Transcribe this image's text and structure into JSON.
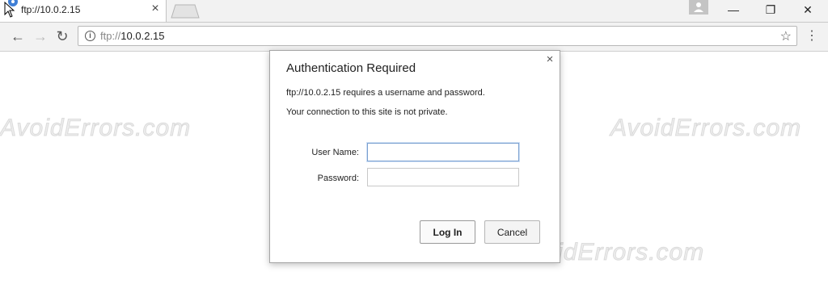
{
  "tab": {
    "title": "ftp://10.0.2.15",
    "close_label": "×"
  },
  "window": {
    "minimize_label": "—",
    "restore_label": "❐",
    "close_label": "✕"
  },
  "toolbar": {
    "back_label": "←",
    "forward_label": "→",
    "reload_label": "↻",
    "url_protocol": "ftp://",
    "url_host": "10.0.2.15",
    "bookmark_label": "☆",
    "menu_label": "⋮"
  },
  "watermark": {
    "text": "AvoidErrors.com"
  },
  "dialog": {
    "title": "Authentication Required",
    "message_line1": "ftp://10.0.2.15 requires a username and password.",
    "message_line2": "Your connection to this site is not private.",
    "close_label": "×",
    "username_label": "User Name:",
    "username_value": "",
    "password_label": "Password:",
    "password_value": "",
    "login_button": "Log In",
    "cancel_button": "Cancel"
  },
  "icons": {
    "favicon": "ftp-favicon-icon",
    "info": "info-icon",
    "bookmark": "star-icon",
    "menu": "kebab-menu-icon",
    "profile": "profile-icon"
  },
  "colors": {
    "focus_border": "#7aa0d0",
    "favicon": "#3f7fd6"
  }
}
